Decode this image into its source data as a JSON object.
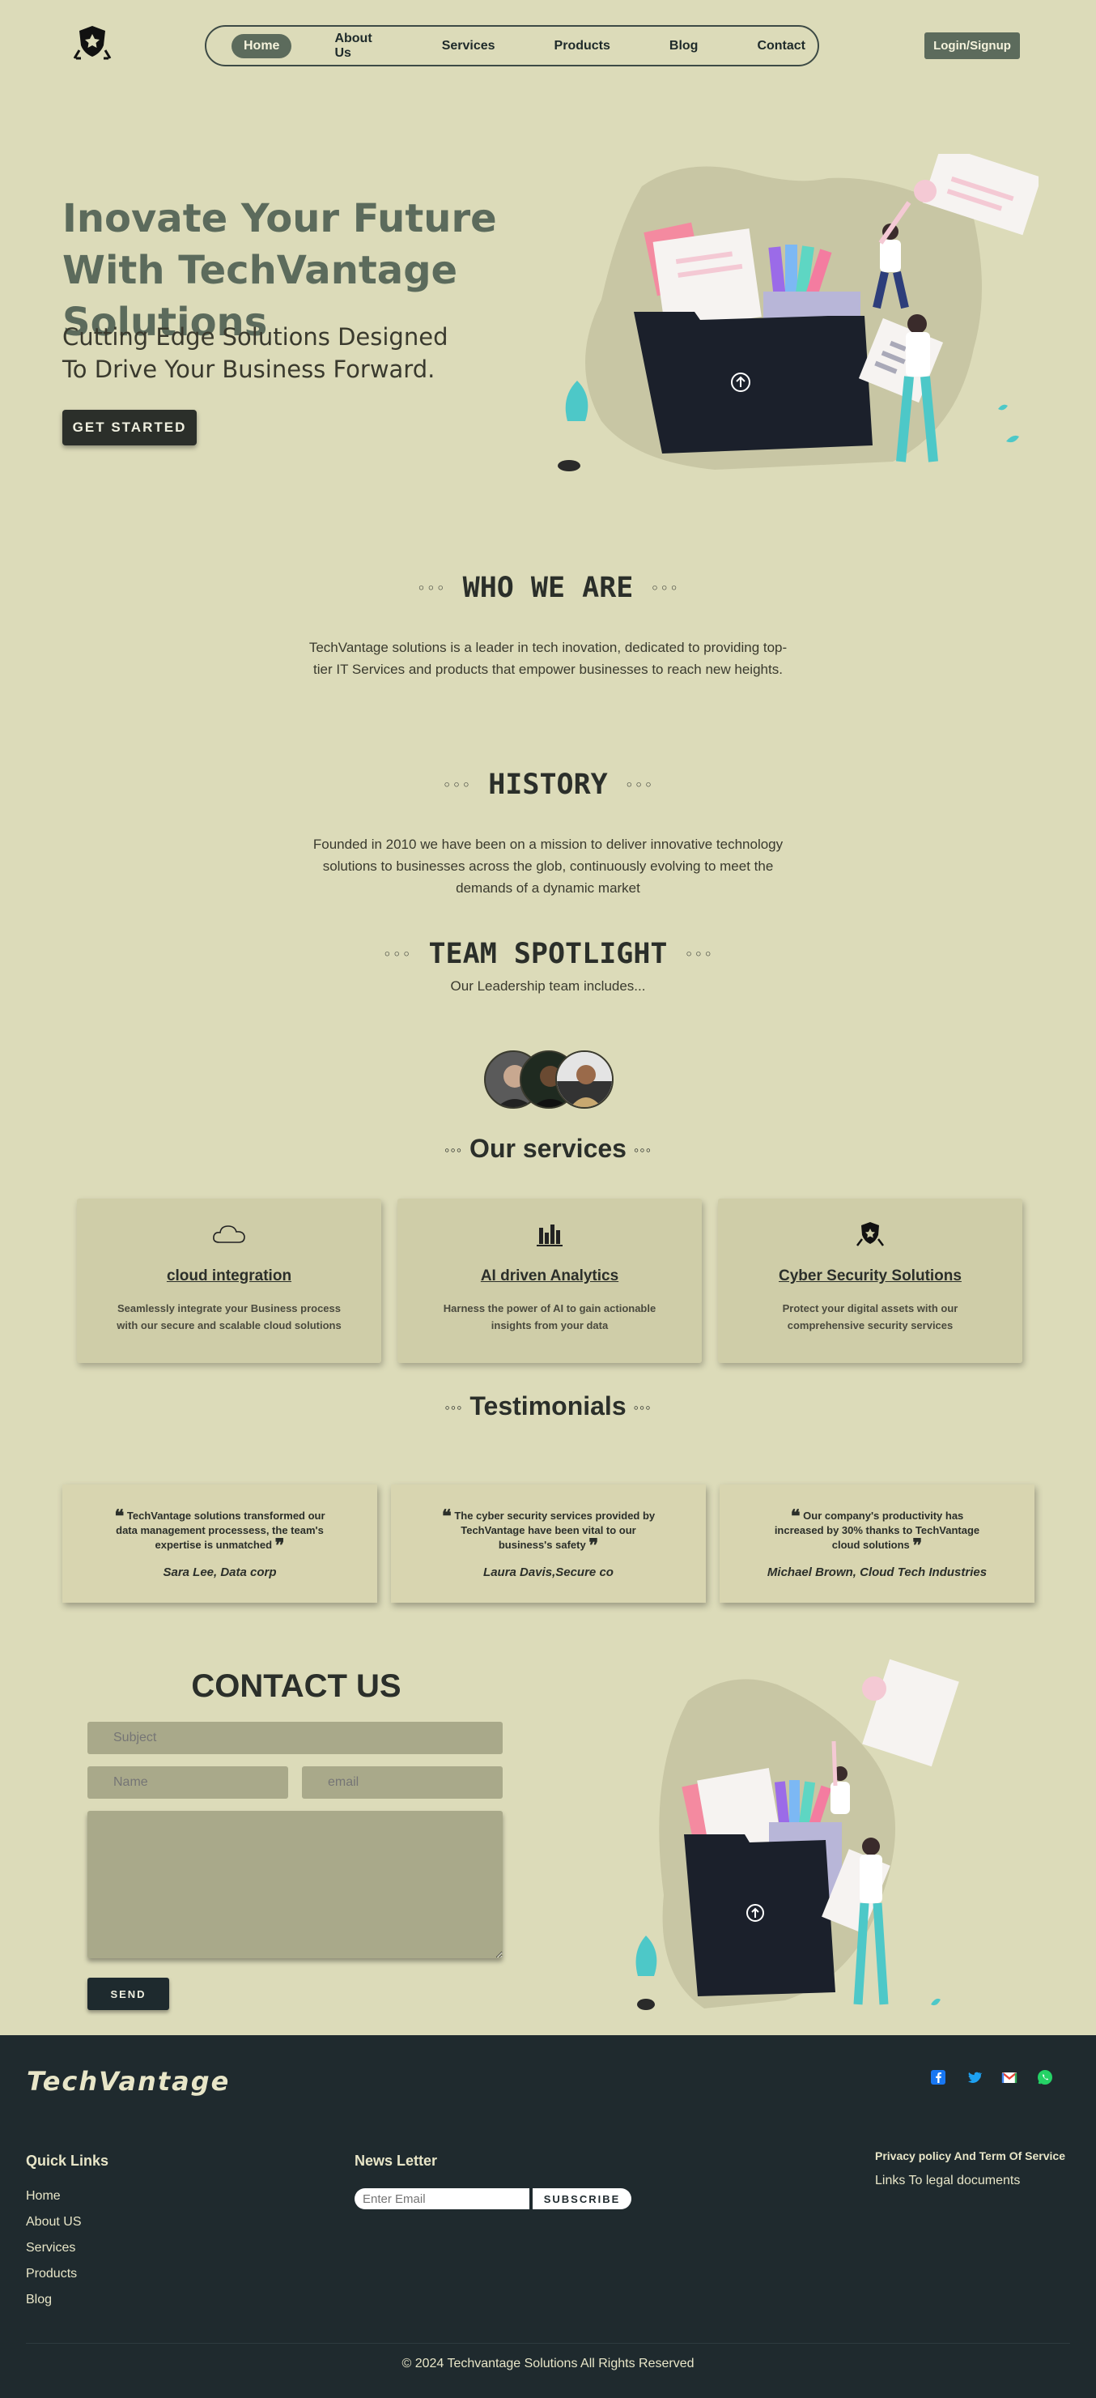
{
  "nav": {
    "items": [
      "Home",
      "About Us",
      "Services",
      "Products",
      "Blog",
      "Contact"
    ],
    "active": "Home",
    "login_label": "Login/Signup"
  },
  "hero": {
    "title": "Inovate Your Future With TechVantage Solutions",
    "subtitle_line1": "Cutting Edge Solutions Designed",
    "subtitle_line2": "To Drive Your Business Forward.",
    "cta": "GET STARTED"
  },
  "sections": {
    "dots": "◦◦◦",
    "who_title": "WHO WE ARE",
    "who_text": "TechVantage solutions is a leader in tech inovation, dedicated to providing top-tier IT Services and products that empower businesses to reach new heights.",
    "history_title": "HISTORY",
    "history_text": "Founded in 2010 we have been on a mission to deliver innovative technology solutions to businesses across the glob, continuously evolving to meet the demands of a dynamic market",
    "team_title": "TEAM SPOTLIGHT",
    "team_sub": "Our Leadership team includes...",
    "services_title": "Our services",
    "testimonials_title": "Testimonials"
  },
  "services": [
    {
      "icon": "cloud-icon",
      "title": "cloud integration",
      "text": "Seamlessly integrate your Business process with our secure and scalable cloud solutions"
    },
    {
      "icon": "chart-icon",
      "title": "AI driven Analytics",
      "text": "Harness the power of AI to gain actionable insights from your data"
    },
    {
      "icon": "shield-icon",
      "title": "Cyber Security Solutions",
      "text": "Protect your digital assets with our comprehensive security services"
    }
  ],
  "testimonials": [
    {
      "quote": "TechVantage solutions transformed our data management processess, the team's expertise is unmatched",
      "author": "Sara Lee, Data corp"
    },
    {
      "quote": "The cyber security services provided by TechVantage have been vital to our business's safety",
      "author": "Laura Davis,Secure co"
    },
    {
      "quote": "Our company's productivity has increased by 30% thanks to TechVantage cloud solutions",
      "author": "Michael Brown, Cloud Tech Industries"
    }
  ],
  "contact": {
    "title": "CONTACT US",
    "subject_placeholder": "Subject",
    "name_placeholder": "Name",
    "email_placeholder": "email",
    "send_label": "SEND"
  },
  "footer": {
    "brand": "TechVantage",
    "social_icons": [
      "facebook-icon",
      "twitter-icon",
      "gmail-icon",
      "whatsapp-icon"
    ],
    "quick_links_title": "Quick Links",
    "quick_links": [
      "Home",
      "About US",
      "Services",
      "Products",
      "Blog"
    ],
    "newsletter_title": "News Letter",
    "newsletter_placeholder": "Enter Email",
    "subscribe_label": "SUBSCRIBE",
    "privacy_title": "Privacy policy And Term Of Service",
    "legal_link": "Links To legal documents",
    "copyright": "© 2024 Techvantage Solutions All Rights Reserved"
  },
  "colors": {
    "background": "#dcdbb9",
    "accent": "#5c6b5c",
    "dark": "#1f2a2e"
  }
}
